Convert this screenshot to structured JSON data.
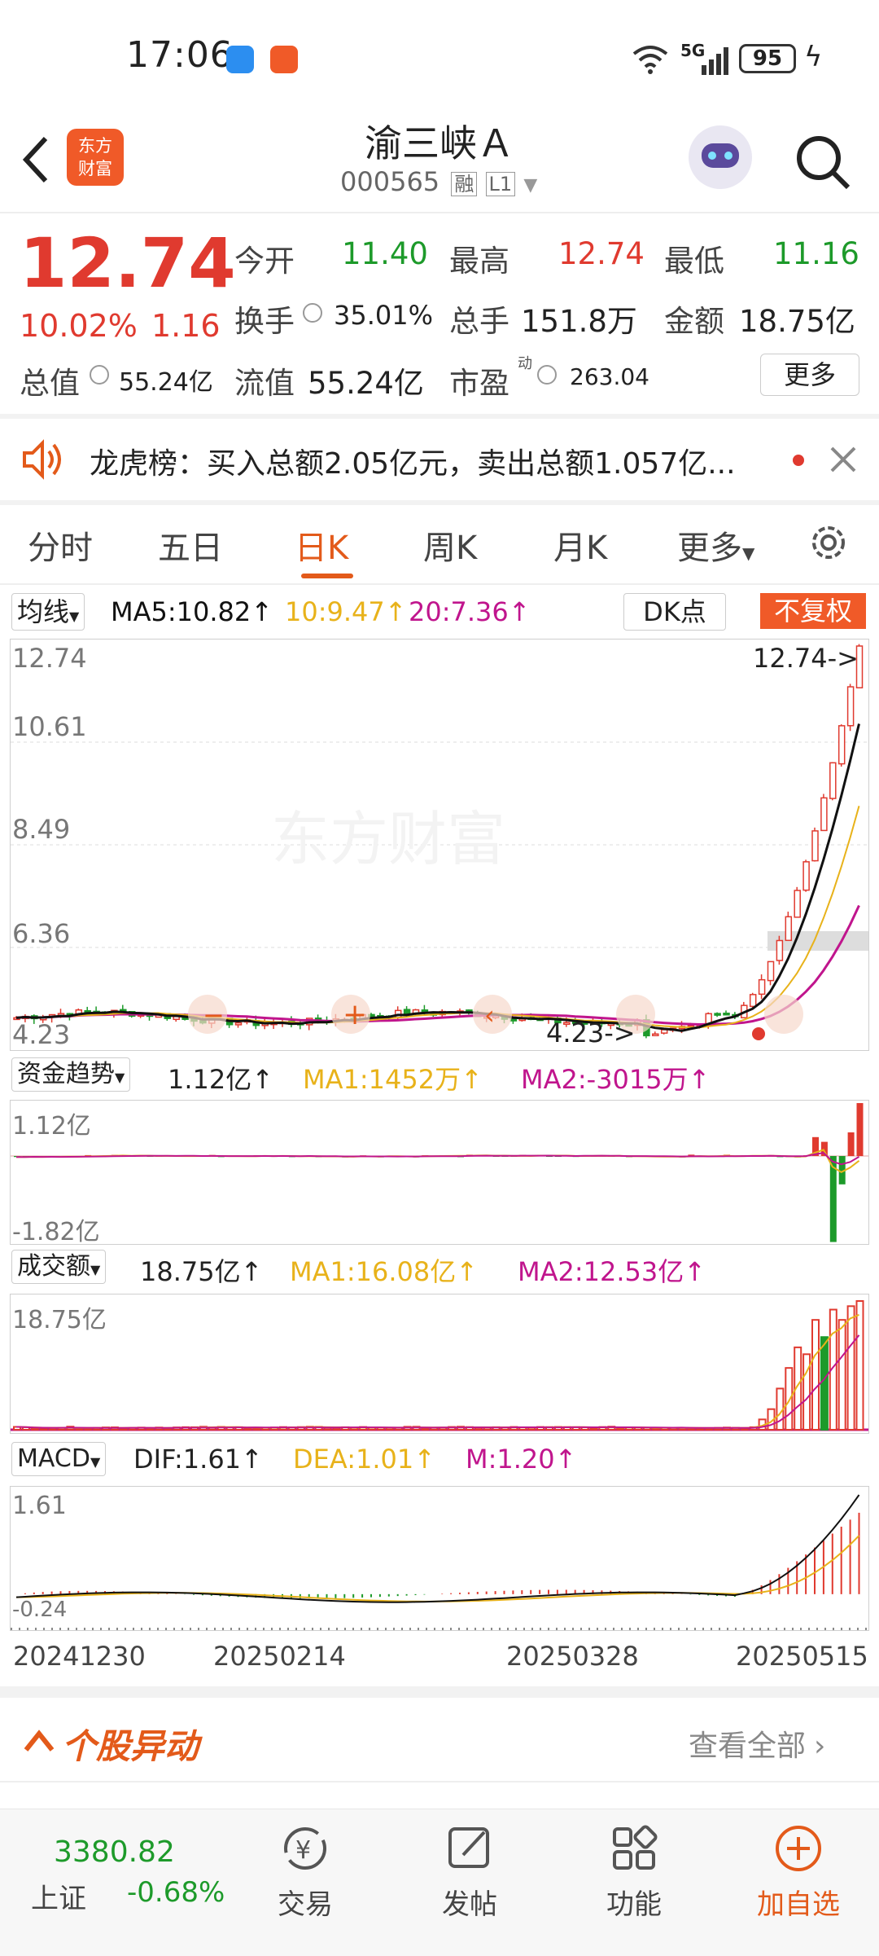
{
  "status": {
    "time": "17:06",
    "network": "5G",
    "battery": "95"
  },
  "header": {
    "title": "渝三峡Ａ",
    "code": "000565",
    "badge_rong": "融",
    "badge_level": "L1"
  },
  "quote": {
    "price": "12.74",
    "change_pct": "10.02%",
    "change": "1.16",
    "open_label": "今开",
    "open": "11.40",
    "high_label": "最高",
    "high": "12.74",
    "low_label": "最低",
    "low": "11.16",
    "turnover_label": "换手",
    "turnover": "35.01%",
    "volume_label": "总手",
    "volume": "151.8万",
    "amount_label": "金额",
    "amount": "18.75亿",
    "mcap_label": "总值",
    "mcap": "55.24亿",
    "float_label": "流值",
    "float": "55.24亿",
    "pe_label": "市盈",
    "pe_sup": "动",
    "pe": "263.04",
    "more": "更多"
  },
  "news": {
    "text": "龙虎榜：买入总额2.05亿元，卖出总额1.057亿..."
  },
  "tabs": [
    "分时",
    "五日",
    "日K",
    "周K",
    "月K",
    "更多"
  ],
  "active_tab": "日K",
  "kline": {
    "ma_selector": "均线",
    "ma5": "MA5:10.82↑",
    "ma10": "10:9.47↑",
    "ma20": "20:7.36↑",
    "dk": "DK点",
    "adjust": "不复权",
    "y_labels": [
      "12.74",
      "10.61",
      "8.49",
      "6.36",
      "4.23"
    ],
    "high_marker": "12.74->",
    "low_marker": "4.23->",
    "watermark": "东方财富"
  },
  "fund": {
    "selector": "资金趋势",
    "value": "1.12亿↑",
    "ma1": "MA1:1452万↑",
    "ma2": "MA2:-3015万↑",
    "y_top": "1.12亿",
    "y_bottom": "-1.82亿"
  },
  "volume": {
    "selector": "成交额",
    "value": "18.75亿↑",
    "ma1": "MA1:16.08亿↑",
    "ma2": "MA2:12.53亿↑",
    "y_top": "18.75亿"
  },
  "macd": {
    "selector": "MACD",
    "dif": "DIF:1.61↑",
    "dea": "DEA:1.01↑",
    "m": "M:1.20↑",
    "y_top": "1.61",
    "y_bottom": "-0.24"
  },
  "dates": [
    "20241230",
    "20250214",
    "20250328",
    "20250515"
  ],
  "section": {
    "title": "个股异动",
    "view_all": "查看全部"
  },
  "bottom_nav": {
    "index_value": "3380.82",
    "index_name": "上证",
    "index_change": "-0.68%",
    "trade": "交易",
    "post": "发帖",
    "function": "功能",
    "add_watch": "加自选"
  },
  "colors": {
    "up": "#e03a2f",
    "down": "#1d9a2a",
    "accent": "#e35a1a",
    "ma5": "#111111",
    "ma10": "#e8b21a",
    "ma20": "#c0158d"
  }
}
